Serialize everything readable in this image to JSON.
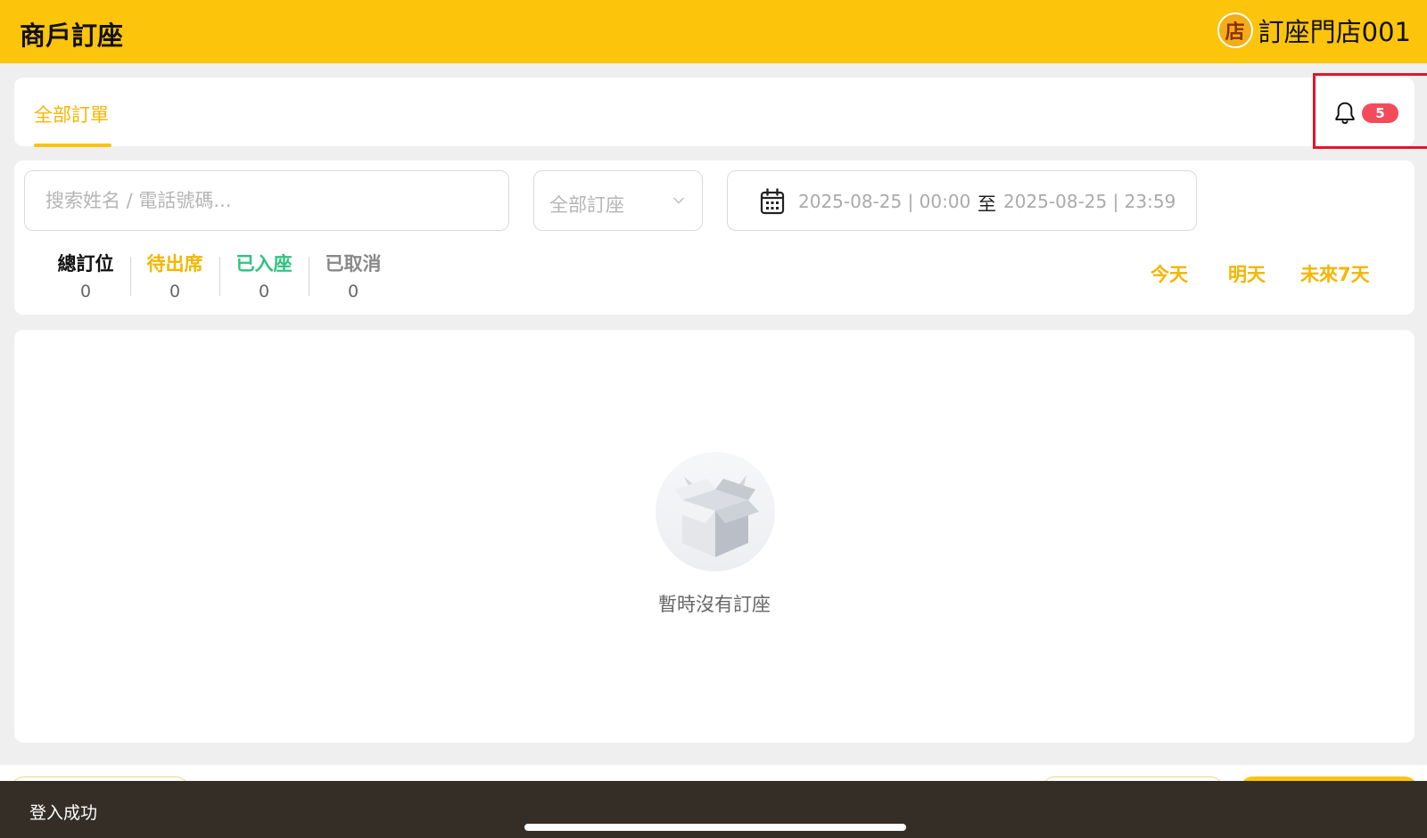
{
  "header": {
    "title": "商戶訂座",
    "store_avatar_text": "店",
    "store_name": "訂座門店001"
  },
  "tabs": {
    "active_label": "全部訂單",
    "notification_count": "5"
  },
  "filters": {
    "search_placeholder": "搜索姓名 / 電話號碼...",
    "booking_type_value": "全部訂座",
    "date_start": "2025-08-25 | 00:00",
    "date_separator": "至",
    "date_end": "2025-08-25 | 23:59"
  },
  "stats": [
    {
      "label": "總訂位",
      "count": "0",
      "color": "#111111"
    },
    {
      "label": "待出席",
      "count": "0",
      "color": "#f5b500"
    },
    {
      "label": "已入座",
      "count": "0",
      "color": "#2ec27e"
    },
    {
      "label": "已取消",
      "count": "0",
      "color": "#888888"
    }
  ],
  "quick_ranges": {
    "today": "今天",
    "tomorrow": "明天",
    "next_7_days": "未來7天"
  },
  "empty_state": {
    "message": "暫時沒有訂座"
  },
  "snackbar": {
    "message": "登入成功"
  },
  "colors": {
    "brand": "#fdc40c",
    "accent_text": "#f5b500",
    "badge": "#f34b5b",
    "highlight_border": "#e0172b"
  }
}
